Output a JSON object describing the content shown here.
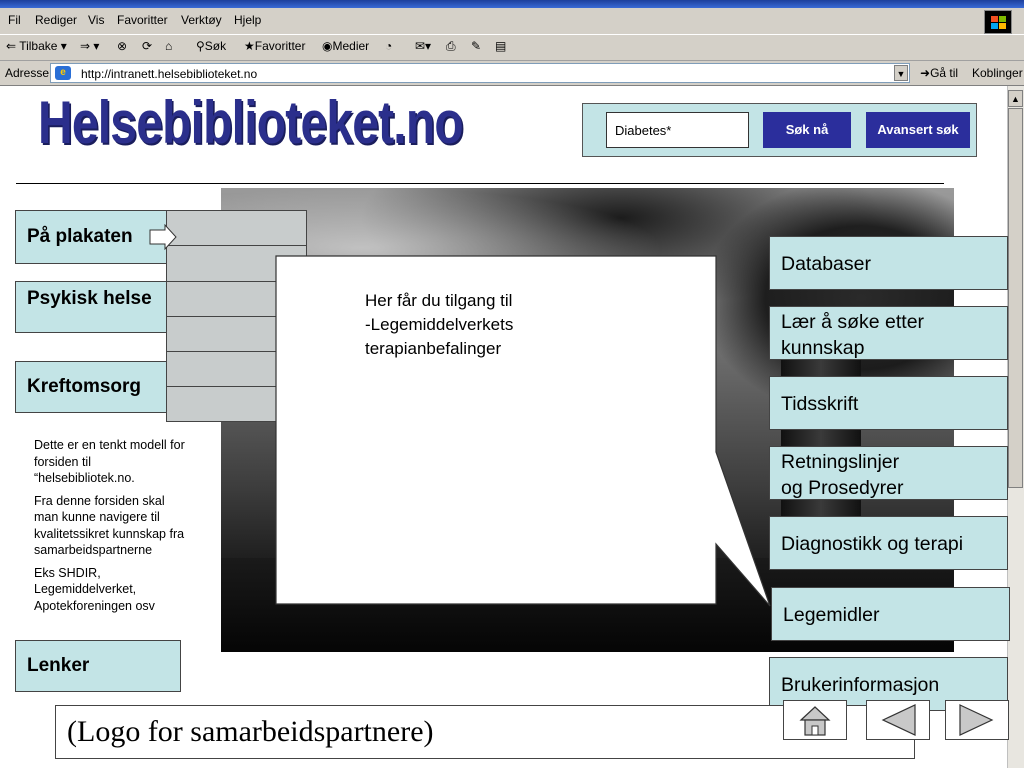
{
  "browser": {
    "menu": [
      "Fil",
      "Rediger",
      "Vis",
      "Favoritter",
      "Verktøy",
      "Hjelp"
    ],
    "toolbar": {
      "back": "Tilbake",
      "search": "Søk",
      "favorites": "Favoritter",
      "media": "Medier"
    },
    "address": {
      "label": "Adresse",
      "url": "http://intranett.helsebiblioteket.no",
      "go": "Gå til",
      "links": "Koblinger"
    }
  },
  "site": {
    "logo": "Helsebiblioteket.no",
    "search": {
      "value": "Diabetes*",
      "button": "Søk nå",
      "advanced": "Avansert søk"
    },
    "left_nav": [
      "På plakaten",
      "Psykisk helse",
      "Kreftomsorg",
      "Lenker"
    ],
    "note": [
      "Dette er en tenkt modell for forsiden til “helsebibliotek.no.",
      "Fra denne forsiden skal man kunne navigere til kvalitetssikret kunnskap fra samarbeidspartnerne",
      "Eks SHDIR, Legemiddelverket, Apotekforeningen osv"
    ],
    "callout_lines": [
      "Her får du tilgang til",
      "-Legemiddelverkets",
      "terapianbefalinger"
    ],
    "right_nav": {
      "databaser": "Databaser",
      "laer": "Lær å søke etter kunnskap",
      "tidsskrift": "Tidsskrift",
      "retningslinjer_1": "Retningslinjer",
      "retningslinjer_2": "og Prosedyrer",
      "diagnostikk": "Diagnostikk og terapi",
      "legemidler": "Legemidler",
      "brukerinformasjon": "Brukerinformasjon"
    },
    "partner_logo": "(Logo for samarbeidspartnere)"
  },
  "colors": {
    "panel": "#c3e4e6",
    "logo": "#2b2f8c",
    "button": "#2b2e9c",
    "chrome": "#d4d0c8"
  },
  "icons": [
    "back-arrow-icon",
    "forward-arrow-icon",
    "stop-icon",
    "refresh-icon",
    "home-icon",
    "search-icon",
    "favorites-icon",
    "media-icon",
    "history-icon",
    "mail-icon",
    "print-icon",
    "edit-icon",
    "go-icon",
    "windows-flag-icon",
    "home-nav-icon",
    "prev-triangle-icon",
    "next-triangle-icon"
  ]
}
